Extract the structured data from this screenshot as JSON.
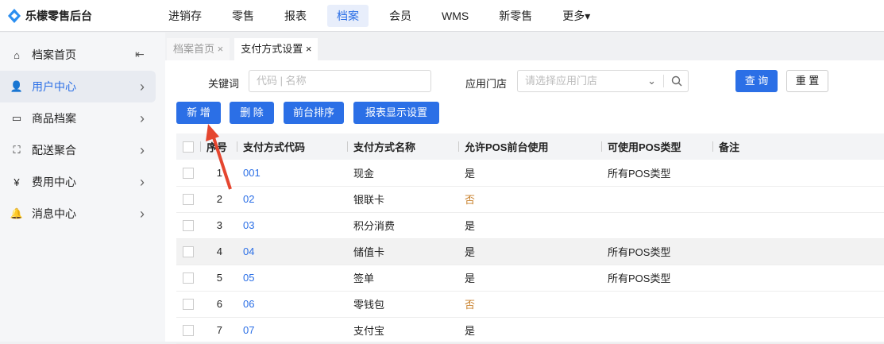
{
  "header": {
    "app_title": "乐檬零售后台",
    "nav": [
      {
        "label": "进销存"
      },
      {
        "label": "零售"
      },
      {
        "label": "报表"
      },
      {
        "label": "档案",
        "active": true
      },
      {
        "label": "会员"
      },
      {
        "label": "WMS"
      },
      {
        "label": "新零售"
      },
      {
        "label": "更多▾"
      }
    ]
  },
  "sidebar": {
    "items": [
      {
        "label": "档案首页"
      },
      {
        "label": "用户中心",
        "active": true
      },
      {
        "label": "商品档案"
      },
      {
        "label": "配送聚合"
      },
      {
        "label": "费用中心"
      },
      {
        "label": "消息中心"
      }
    ]
  },
  "tabs": [
    {
      "label": "档案首页 ×"
    },
    {
      "label": "支付方式设置 ×",
      "active": true
    }
  ],
  "filters": {
    "keyword_label": "关键词",
    "keyword_placeholder": "代码 | 名称",
    "store_label": "应用门店",
    "store_placeholder": "请选择应用门店",
    "query": "查 询",
    "reset": "重 置"
  },
  "toolbar": {
    "add": "新 增",
    "delete": "删 除",
    "sort": "前台排序",
    "display": "报表显示设置"
  },
  "table": {
    "headers": [
      "序号",
      "支付方式代码",
      "支付方式名称",
      "允许POS前台使用",
      "可使用POS类型",
      "备注"
    ],
    "rows": [
      [
        "1",
        "001",
        "现金",
        "是",
        "所有POS类型",
        ""
      ],
      [
        "2",
        "02",
        "银联卡",
        "否",
        "",
        ""
      ],
      [
        "3",
        "03",
        "积分消费",
        "是",
        "",
        ""
      ],
      [
        "4",
        "04",
        "储值卡",
        "是",
        "所有POS类型",
        ""
      ],
      [
        "5",
        "05",
        "签单",
        "是",
        "所有POS类型",
        ""
      ],
      [
        "6",
        "06",
        "零钱包",
        "否",
        "",
        ""
      ],
      [
        "7",
        "07",
        "支付宝",
        "是",
        "",
        ""
      ]
    ]
  },
  "colors": {
    "accent": "#2b6fe6",
    "no": "#c9822e",
    "arrow": "#e5462f"
  }
}
